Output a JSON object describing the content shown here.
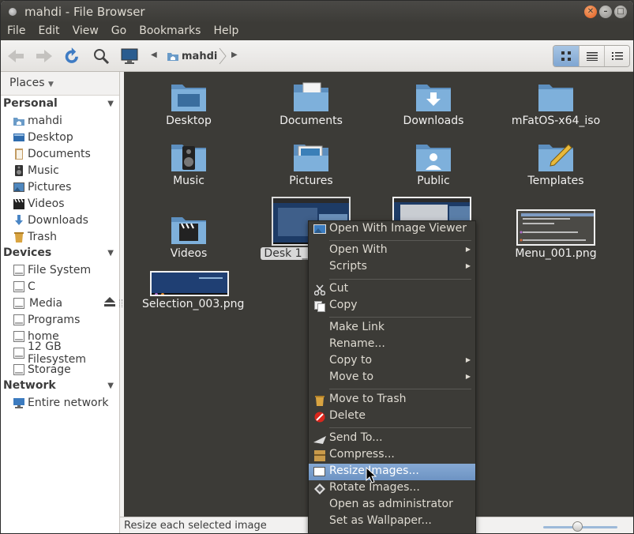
{
  "window": {
    "title": "mahdi - File Browser"
  },
  "menubar": {
    "items": [
      "File",
      "Edit",
      "View",
      "Go",
      "Bookmarks",
      "Help"
    ]
  },
  "toolbar": {
    "location": "mahdi"
  },
  "sidebar": {
    "places_label": "Places",
    "sections": [
      {
        "label": "Personal",
        "items": [
          "mahdi",
          "Desktop",
          "Documents",
          "Music",
          "Pictures",
          "Videos",
          "Downloads",
          "Trash"
        ]
      },
      {
        "label": "Devices",
        "items": [
          "File System",
          "C",
          "Media",
          "Programs",
          "home",
          "12 GB Filesystem",
          "Storage"
        ]
      },
      {
        "label": "Network",
        "items": [
          "Entire network"
        ]
      }
    ]
  },
  "files": [
    {
      "name": "Desktop",
      "kind": "folder"
    },
    {
      "name": "Documents",
      "kind": "folder"
    },
    {
      "name": "Downloads",
      "kind": "folder"
    },
    {
      "name": "mFatOS-x64_iso",
      "kind": "folder"
    },
    {
      "name": "Music",
      "kind": "folder"
    },
    {
      "name": "Pictures",
      "kind": "folder"
    },
    {
      "name": "Public",
      "kind": "folder"
    },
    {
      "name": "Templates",
      "kind": "folder"
    },
    {
      "name": "Videos",
      "kind": "folder"
    },
    {
      "name": "Desk 1_",
      "kind": "image",
      "selected": true
    },
    {
      "name": "",
      "kind": "image"
    },
    {
      "name": "Menu_001.png",
      "kind": "image"
    },
    {
      "name": "Selection_003.png",
      "kind": "image"
    }
  ],
  "context_menu": {
    "items": [
      {
        "label": "Open With Image Viewer",
        "icon": "image-viewer-icon"
      },
      {
        "label": "Open With",
        "submenu": true
      },
      {
        "label": "Scripts",
        "submenu": true
      },
      {
        "label": "Cut",
        "icon": "scissors-icon"
      },
      {
        "label": "Copy",
        "icon": "copy-icon"
      },
      {
        "label": "Make Link"
      },
      {
        "label": "Rename..."
      },
      {
        "label": "Copy to",
        "submenu": true
      },
      {
        "label": "Move to",
        "submenu": true
      },
      {
        "label": "Move to Trash",
        "icon": "trash-icon"
      },
      {
        "label": "Delete",
        "icon": "delete-icon"
      },
      {
        "label": "Send To...",
        "icon": "send-icon"
      },
      {
        "label": "Compress...",
        "icon": "archive-icon"
      },
      {
        "label": "Resize Images...",
        "icon": "resize-icon",
        "highlighted": true
      },
      {
        "label": "Rotate Images...",
        "icon": "rotate-icon"
      },
      {
        "label": "Open as administrator"
      },
      {
        "label": "Set as Wallpaper..."
      }
    ]
  },
  "statusbar": {
    "text": "Resize each selected image"
  },
  "colors": {
    "view_bg": "#3c3b37",
    "highlight": "#7099c8",
    "folder": "#6a9bc8",
    "accent_orange": "#e05a1d"
  }
}
